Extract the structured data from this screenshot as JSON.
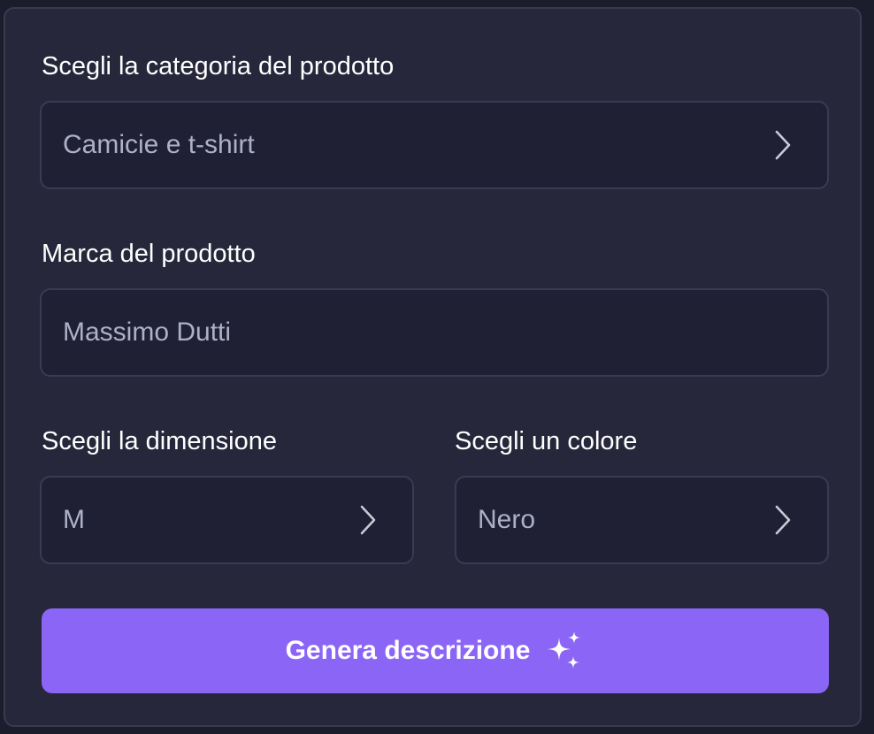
{
  "form": {
    "category": {
      "label": "Scegli la categoria del prodotto",
      "value": "Camicie e t-shirt",
      "icon": "chevron-right-icon"
    },
    "brand": {
      "label": "Marca del prodotto",
      "value": "Massimo Dutti"
    },
    "size": {
      "label": "Scegli la dimensione",
      "value": "M",
      "icon": "chevron-right-icon"
    },
    "color": {
      "label": "Scegli un colore",
      "value": "Nero",
      "icon": "chevron-right-icon"
    },
    "submit": {
      "label": "Genera descrizione",
      "icon": "sparkles-icon"
    }
  },
  "theme": {
    "page_bg": "#1b1c2c",
    "card_bg": "#26273b",
    "field_bg": "#1f2033",
    "border": "#3a3b51",
    "accent": "#8b65f5",
    "text": "#ffffff",
    "muted_text": "#aeb0c6"
  }
}
